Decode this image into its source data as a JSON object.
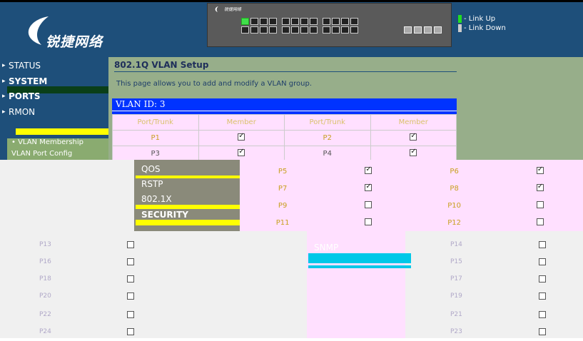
{
  "header": {
    "brand": "锐捷网络",
    "panel_brand": "锐捷网络",
    "legend": {
      "up_label": "- Link Up",
      "down_label": "- Link Down",
      "up_color": "#22dd22",
      "down_color": "#cccccc"
    }
  },
  "nav": {
    "status": "STATUS",
    "system": "SYSTEM",
    "ports": "PORTS",
    "rmon": "RMON",
    "vlan_membership": "• VLAN Membership",
    "vlan_port_config": "VLAN Port Config",
    "qos": "QOS",
    "rstp": "RSTP",
    "dot1x": "802.1X",
    "security": "SECURITY",
    "snmp": "SNMP"
  },
  "page": {
    "title": "802.1Q VLAN Setup",
    "intro": "This page allows you to add and modify a VLAN group.",
    "vlan_id_label": "VLAN ID: 3"
  },
  "table": {
    "headers": [
      "Port/Trunk",
      "Member",
      "Port/Trunk",
      "Member"
    ],
    "rows": [
      {
        "left_port": "P1",
        "left_member": true,
        "right_port": "P2",
        "right_member": true
      },
      {
        "left_port": "P3",
        "left_member": true,
        "right_port": "P4",
        "right_member": true
      },
      {
        "left_port": "P5",
        "left_member": true,
        "right_port": "P6",
        "right_member": true
      },
      {
        "left_port": "P7",
        "left_member": true,
        "right_port": "P8",
        "right_member": true
      },
      {
        "left_port": "P9",
        "left_member": false,
        "right_port": "P10",
        "right_member": false
      },
      {
        "left_port": "P11",
        "left_member": false,
        "right_port": "P12",
        "right_member": false
      },
      {
        "left_port": "P13",
        "left_member": false,
        "right_port": "P14",
        "right_member": false
      },
      {
        "left_port": "P16",
        "left_member": false,
        "right_port": "P15",
        "right_member": false
      },
      {
        "left_port": "P18",
        "left_member": false,
        "right_port": "P17",
        "right_member": false
      },
      {
        "left_port": "P20",
        "left_member": false,
        "right_port": "P19",
        "right_member": false
      },
      {
        "left_port": "P22",
        "left_member": false,
        "right_port": "P21",
        "right_member": false
      },
      {
        "left_port": "P24",
        "left_member": false,
        "right_port": "P23",
        "right_member": false
      }
    ]
  }
}
